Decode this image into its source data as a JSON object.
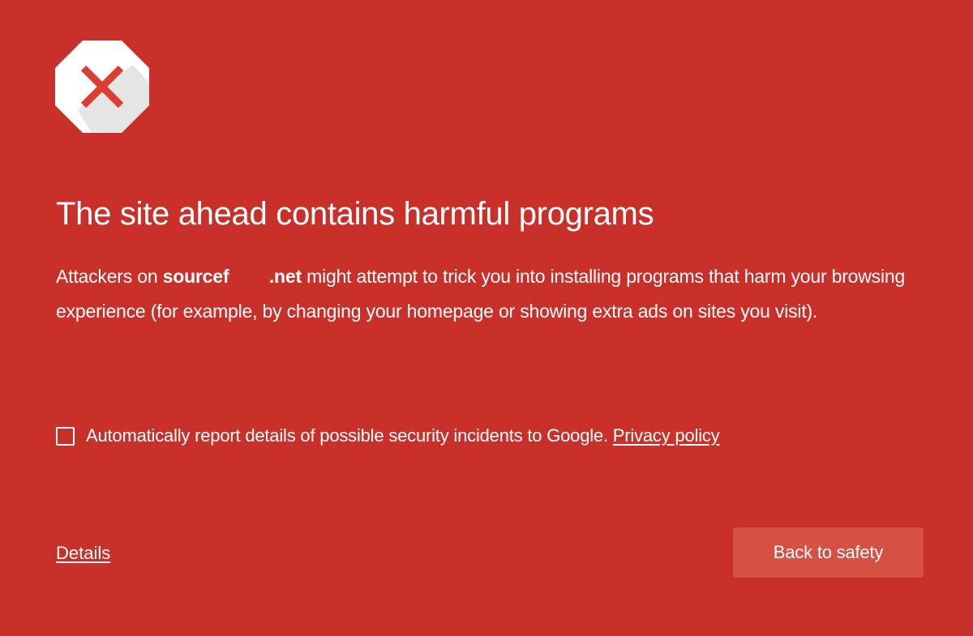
{
  "colors": {
    "background": "#c9302a",
    "text": "#ffffff",
    "button_background": "#d65044",
    "icon_x": "#dd3d31",
    "icon_shadow": "#dcdcdc"
  },
  "icon": {
    "name": "stop-sign-x-icon"
  },
  "headline": "The site ahead contains harmful programs",
  "message": {
    "prefix": "Attackers on ",
    "domain": "sourcef        .net",
    "suffix": " might attempt to trick you into installing programs that harm your browsing experience (for example, by changing your homepage or showing extra ads on sites you visit)."
  },
  "report": {
    "checked": false,
    "text": "Automatically report details of possible security incidents to Google. ",
    "privacy_link": "Privacy policy"
  },
  "details_link": "Details",
  "back_button": "Back to safety"
}
